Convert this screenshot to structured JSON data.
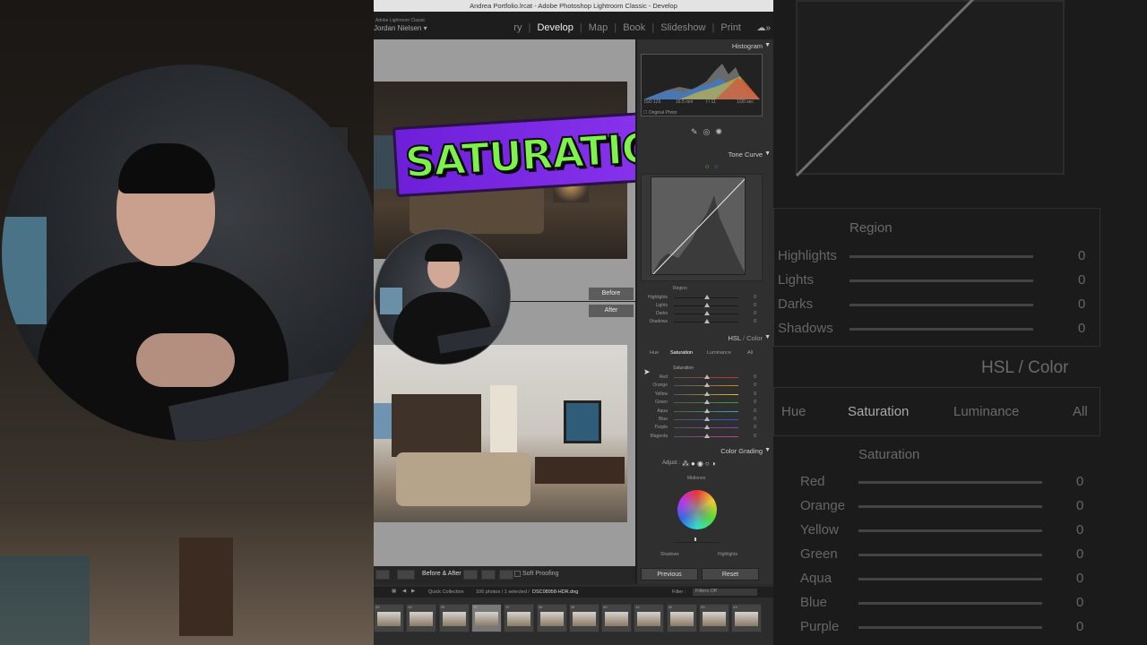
{
  "window": {
    "title": "Andrea Portfolio.lrcat - Adobe Photoshop Lightroom Classic - Develop",
    "brand_small": "Adobe Lightroom Classic",
    "user": "Jordan Nielsen"
  },
  "modules": [
    "ry",
    "Develop",
    "Map",
    "Book",
    "Slideshow",
    "Print"
  ],
  "active_module": "Develop",
  "overlay": {
    "text": "SATURATION"
  },
  "preview": {
    "before_label": "Before",
    "after_label": "After"
  },
  "toolbar": {
    "before_after": "Before & After :",
    "soft_proofing": "Soft Proofing"
  },
  "panel": {
    "histogram": {
      "title": "Histogram",
      "iso": "ISO 125",
      "focal": "16.5 mm",
      "aperture": "f / 11",
      "shutter": "1/30 sec",
      "original_photo": "Original Photo"
    },
    "tone_curve": {
      "title": "Tone Curve",
      "region_label": "Region",
      "rows": [
        {
          "label": "Highlights",
          "value": "0"
        },
        {
          "label": "Lights",
          "value": "0"
        },
        {
          "label": "Darks",
          "value": "0"
        },
        {
          "label": "Shadows",
          "value": "0"
        }
      ]
    },
    "hsl": {
      "title_hsl": "HSL",
      "title_sep": "/",
      "title_color": "Color",
      "tabs": [
        "Hue",
        "Saturation",
        "Luminance",
        "All"
      ],
      "active_tab": "Saturation",
      "section_label": "Saturation",
      "rows": [
        {
          "label": "Red",
          "value": "0",
          "color": "#c0392b"
        },
        {
          "label": "Orange",
          "value": "0",
          "color": "#d9822b"
        },
        {
          "label": "Yellow",
          "value": "0",
          "color": "#d4c22b"
        },
        {
          "label": "Green",
          "value": "0",
          "color": "#3fa33f"
        },
        {
          "label": "Aqua",
          "value": "0",
          "color": "#2bb0b0"
        },
        {
          "label": "Blue",
          "value": "0",
          "color": "#2b5cd4"
        },
        {
          "label": "Purple",
          "value": "0",
          "color": "#8e3fc4"
        },
        {
          "label": "Magenta",
          "value": "0",
          "color": "#c43fa0"
        }
      ]
    },
    "color_grading": {
      "title": "Color Grading",
      "adjust_label": "Adjust :",
      "midtones_label": "Midtones",
      "shadows_label": "Shadows",
      "highlights_label": "Highlights"
    },
    "previous_button": "Previous",
    "reset_button": "Reset"
  },
  "filmstrip": {
    "collection": "Quick Collection",
    "selection_info": "106 photos / 1 selected /",
    "filename": "DSC08958-HDR.dng",
    "filter_label": "Filter :",
    "filter_value": "Filters Off",
    "thumb_numbers": [
      "33",
      "34",
      "35",
      "36",
      "37",
      "38",
      "39",
      "40",
      "41",
      "42",
      "43",
      "44"
    ]
  },
  "background": {
    "region_label": "Region",
    "rows": [
      {
        "label": "Highlights",
        "value": "0"
      },
      {
        "label": "Lights",
        "value": "0"
      },
      {
        "label": "Darks",
        "value": "0"
      },
      {
        "label": "Shadows",
        "value": "0"
      }
    ],
    "hsl_title": "HSL / Color",
    "tabs": [
      "Hue",
      "Saturation",
      "Luminance",
      "All"
    ],
    "section_label": "Saturation",
    "hsl_rows": [
      {
        "label": "Red",
        "value": "0"
      },
      {
        "label": "Orange",
        "value": "0"
      },
      {
        "label": "Yellow",
        "value": "0"
      },
      {
        "label": "Green",
        "value": "0"
      },
      {
        "label": "Aqua",
        "value": "0"
      },
      {
        "label": "Blue",
        "value": "0"
      },
      {
        "label": "Purple",
        "value": "0"
      }
    ]
  },
  "colors": {
    "overlay_bg": "#7b2ae4",
    "overlay_text": "#7cf24a",
    "panel_bg": "#2f2f2f"
  }
}
